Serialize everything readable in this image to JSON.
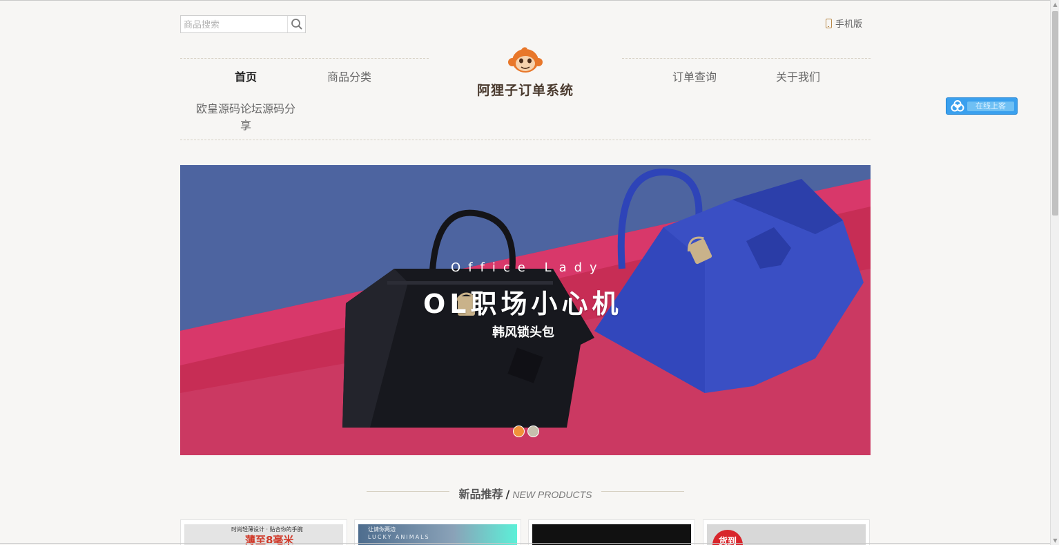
{
  "search": {
    "placeholder": "商品搜索"
  },
  "header": {
    "mobile_label": "手机版"
  },
  "nav": {
    "items": [
      {
        "label": "首页",
        "active": true
      },
      {
        "label": "商品分类"
      },
      {
        "label": "订单查询"
      },
      {
        "label": "关于我们"
      }
    ],
    "extra_line1": "欧皇源码论坛源码分",
    "extra_line2": "享"
  },
  "logo": {
    "title": "阿狸子订单系统"
  },
  "online_service": {
    "label": "在线上客"
  },
  "banner": {
    "subtitle": "Office Lady",
    "title": "OL职场小心机",
    "tagline": "韩风锁头包",
    "slides": 2,
    "active_slide": 1
  },
  "section": {
    "title_cn": "新品推荐",
    "title_en": "NEW PRODUCTS"
  },
  "products": [
    {
      "caption": "时尚轻薄设计 · 贴合你的手腕",
      "headline": "薄至8毫米"
    },
    {
      "caption": "让请你两边",
      "subcaption": "LUCKY ANIMALS"
    },
    {
      "caption": ""
    },
    {
      "badge": "货到"
    }
  ],
  "colors": {
    "background": "#f7f6f4",
    "accent_orange": "#f0923a",
    "banner_blue": "#5067a0",
    "banner_red": "#c72d55",
    "online_blue": "#3aa0ee"
  }
}
